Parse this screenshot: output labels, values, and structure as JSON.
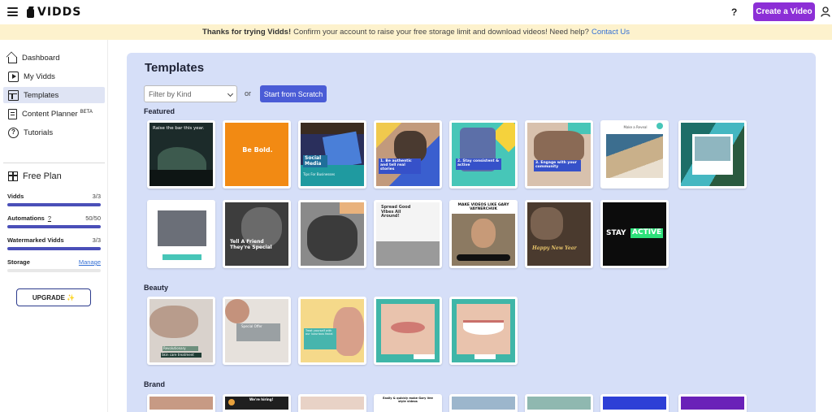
{
  "topbar": {
    "brand": "VIDDS",
    "help": "?",
    "create_label": "Create a Video"
  },
  "notice": {
    "bold": "Thanks for trying Vidds!",
    "text": "Confirm your account to raise your free storage limit and download videos! Need help?",
    "link": "Contact Us"
  },
  "sidebar": {
    "items": [
      {
        "label": "Dashboard",
        "icon": "home-icon"
      },
      {
        "label": "My Vidds",
        "icon": "video-icon"
      },
      {
        "label": "Templates",
        "icon": "template-icon"
      },
      {
        "label": "Content Planner",
        "badge": "BETA",
        "icon": "planner-icon"
      },
      {
        "label": "Tutorials",
        "icon": "help-circle-icon"
      }
    ],
    "plan": {
      "title": "Free Plan",
      "vidds_label": "Vidds",
      "vidds_value": "3/3",
      "vidds_fraction": 1.0,
      "automations_label": "Automations",
      "automations_help": "?",
      "automations_value": "50/50",
      "automations_fraction": 1.0,
      "watermarked_label": "Watermarked Vidds",
      "watermarked_value": "3/3",
      "watermarked_fraction": 1.0,
      "storage_label": "Storage",
      "storage_link": "Manage",
      "storage_fraction": 0.0,
      "upgrade_label": "UPGRADE ✨"
    }
  },
  "main": {
    "title": "Templates",
    "filter_placeholder": "Filter by Kind",
    "or": "or",
    "scratch_label": "Start from Scratch",
    "sections": {
      "featured": "Featured",
      "beauty": "Beauty",
      "brand": "Brand"
    },
    "featured_text": {
      "t1": "Raise the bar this year.",
      "t2": "Be Bold.",
      "t3a": "Social Media",
      "t3b": "Tips For Businesses",
      "t4": "1. Be authentic and tell real stories",
      "t5": "2. Stay consistent & active",
      "t6": "3. Engage with your community",
      "t7": "Make a Reveal",
      "t10": "Tell A Friend They're Special",
      "t12": "Spread Good Vibes All Around!",
      "t13": "MAKE VIDEOS LIKE GARY VAYNERCHUK",
      "t14": "Happy New Year",
      "t15a": "STAY",
      "t15b": "ACTIVE"
    },
    "beauty_text": {
      "b1a": "Revolutionary",
      "b1b": "Skin care treatment",
      "b2": "Special Offer",
      "b3": "Treat yourself with our luxurious facial"
    },
    "brand_text": {
      "r2a": "We're hiring!",
      "r3": "Easily & quickly make Gary Vee style videos"
    }
  }
}
